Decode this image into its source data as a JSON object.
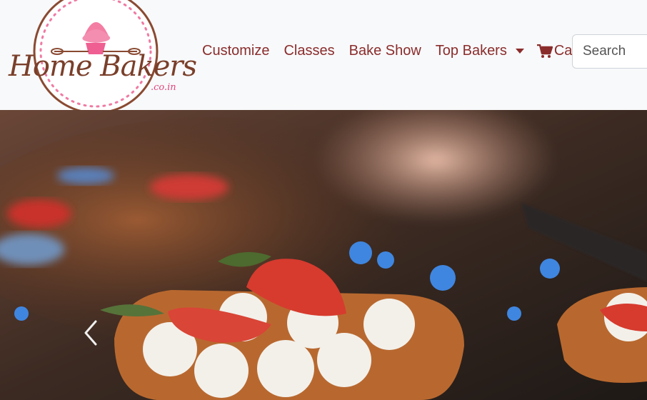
{
  "brand": {
    "name": "Home Bakers",
    "domain": ".co.in",
    "accent": "#e0457b",
    "text_color": "#7a3f2a"
  },
  "nav": {
    "links": [
      {
        "label": "Customize"
      },
      {
        "label": "Classes"
      },
      {
        "label": "Bake Show"
      },
      {
        "label": "Top Bakers"
      }
    ],
    "cart_label": "Cart",
    "link_color": "#8b2c2c"
  },
  "search": {
    "placeholder": "Search"
  },
  "carousel": {
    "prev_icon": "chevron-left-icon"
  }
}
